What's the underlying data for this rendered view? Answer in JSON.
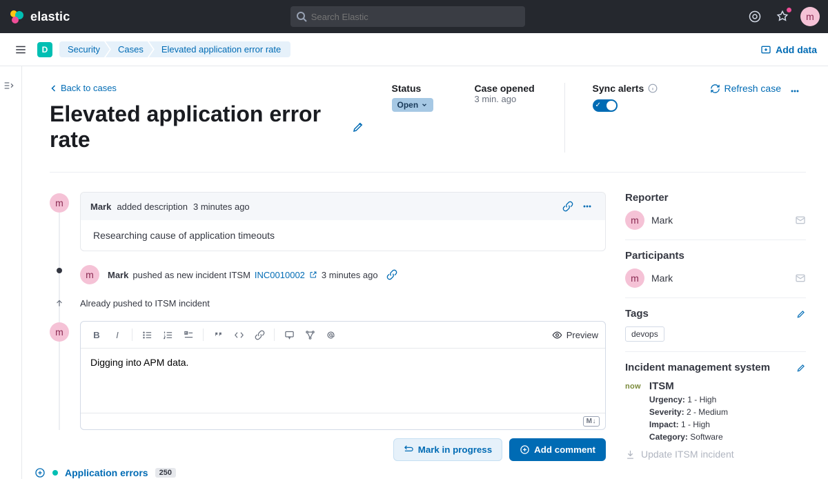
{
  "brand": "elastic",
  "search": {
    "placeholder": "Search Elastic"
  },
  "avatar_initial": "m",
  "subnav": {
    "space_initial": "D",
    "add_data": "Add data"
  },
  "breadcrumbs": [
    "Security",
    "Cases",
    "Elevated application error rate"
  ],
  "backlink": "Back to cases",
  "case": {
    "title": "Elevated application error rate",
    "status_label": "Status",
    "status_value": "Open",
    "opened_label": "Case opened",
    "opened_value": "3 min. ago",
    "sync_label": "Sync alerts",
    "refresh": "Refresh case"
  },
  "activity": {
    "desc_head_user": "Mark",
    "desc_head_action": "added description",
    "desc_head_time": "3 minutes ago",
    "desc_body": "Researching cause of application timeouts",
    "push_user": "Mark",
    "push_action": "pushed as new incident ITSM",
    "push_incident": "INC0010002",
    "push_time": "3 minutes ago",
    "already_pushed": "Already pushed to ITSM incident",
    "editor_value": "Digging into APM data.",
    "preview": "Preview",
    "md_badge": "M↓",
    "mark_progress": "Mark in progress",
    "add_comment": "Add comment"
  },
  "sidebar": {
    "reporter_label": "Reporter",
    "reporter_name": "Mark",
    "participants_label": "Participants",
    "participant_name": "Mark",
    "tags_label": "Tags",
    "tag": "devops",
    "ims_label": "Incident management system",
    "ims_connector": "ITSM",
    "urgency_k": "Urgency:",
    "urgency_v": "1 - High",
    "severity_k": "Severity:",
    "severity_v": "2 - Medium",
    "impact_k": "Impact:",
    "impact_v": "1 - High",
    "category_k": "Category:",
    "category_v": "Software",
    "update_inc": "Update ITSM incident"
  },
  "bottom": {
    "name": "Application errors",
    "count": "250"
  }
}
